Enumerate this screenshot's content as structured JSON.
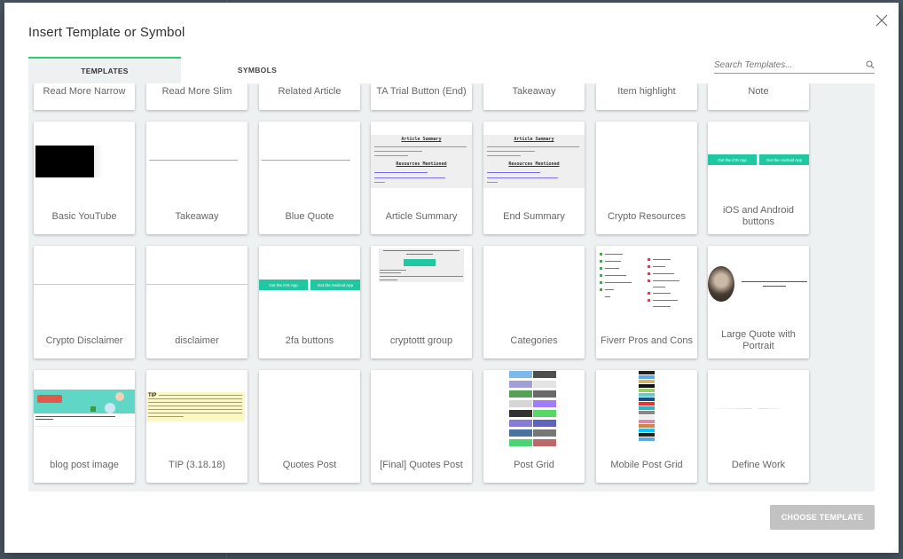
{
  "dialog": {
    "title": "Insert Template or Symbol",
    "close_icon": "close-icon",
    "tabs": [
      {
        "label": "TEMPLATES",
        "active": true
      },
      {
        "label": "SYMBOLS",
        "active": false
      }
    ],
    "search": {
      "placeholder": "Search Templates...",
      "value": "",
      "icon": "search-icon"
    },
    "accent_color": "#2ecc71",
    "choose_button": {
      "label": "CHOOSE TEMPLATE",
      "enabled": false
    }
  },
  "templates": [
    {
      "label": "Read More Narrow"
    },
    {
      "label": "Read More Slim"
    },
    {
      "label": "Related Article"
    },
    {
      "label": "TA Trial Button (End)"
    },
    {
      "label": "Takeaway"
    },
    {
      "label": "Item highlight"
    },
    {
      "label": "Note"
    },
    {
      "label": "Basic YouTube"
    },
    {
      "label": "Takeaway"
    },
    {
      "label": "Blue Quote"
    },
    {
      "label": "Article Summary"
    },
    {
      "label": "End Summary"
    },
    {
      "label": "Crypto Resources"
    },
    {
      "label": "iOS and Android buttons"
    },
    {
      "label": "Crypto Disclaimer"
    },
    {
      "label": "disclaimer"
    },
    {
      "label": "2fa buttons"
    },
    {
      "label": "cryptottt group"
    },
    {
      "label": "Categories"
    },
    {
      "label": "Fiverr Pros and Cons"
    },
    {
      "label": "Large Quote with Portrait"
    },
    {
      "label": "blog post image"
    },
    {
      "label": "TIP (3.18.18)"
    },
    {
      "label": "Quotes Post"
    },
    {
      "label": "[Final] Quotes Post"
    },
    {
      "label": "Post Grid"
    },
    {
      "label": "Mobile Post Grid"
    },
    {
      "label": "Define Work"
    }
  ],
  "previews": {
    "summary_heading": "Article Summary",
    "resources_heading": "Resources Mentioned",
    "ios_button": "Get the iOS App",
    "android_button": "Get the Android App",
    "tip_label": "TIP"
  }
}
